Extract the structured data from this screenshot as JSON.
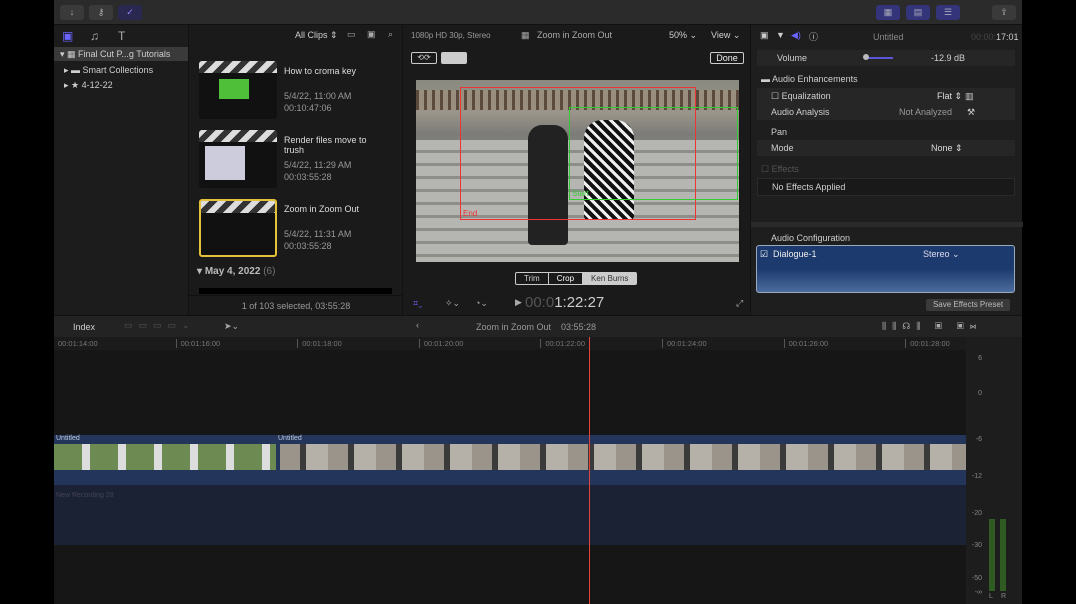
{
  "toolbar": {
    "import_icon": "download-arrow-icon",
    "keywords_icon": "key-icon",
    "background_tasks_icon": "checkmark-circle-icon",
    "accent": "#5b55d8"
  },
  "library": {
    "items": [
      {
        "label": "Final Cut P...g Tutorials"
      },
      {
        "label": "Smart Collections"
      },
      {
        "label": "4-12-22"
      }
    ]
  },
  "browser": {
    "filter": "All Clips",
    "clips": [
      {
        "title": "How to croma key",
        "date": "5/4/22, 11:00 AM",
        "duration": "00:10:47:06"
      },
      {
        "title": "Render files move to trush",
        "date": "5/4/22, 11:29 AM",
        "duration": "00:03:55:28"
      },
      {
        "title": "Zoom in Zoom Out",
        "date": "5/4/22, 11:31 AM",
        "duration": "00:03:55:28"
      }
    ],
    "group_label": "May 4, 2022",
    "group_count": "(6)",
    "status": "1 of 103 selected, 03:55:28"
  },
  "viewer": {
    "format": "1080p HD 30p, Stereo",
    "title": "Zoom in Zoom Out",
    "zoom": "50%",
    "view": "View",
    "done": "Done",
    "end_label": "End",
    "start_label": "Start",
    "modes": [
      "Trim",
      "Crop",
      "Ken Burns"
    ],
    "active_mode": "Crop",
    "timecode_dim": "00:0",
    "timecode": "1:22:27"
  },
  "inspector": {
    "title": "Untitled",
    "tc_dim": "00:00:",
    "tc": "17:01",
    "volume_label": "Volume",
    "volume_value": "-12.9 dB",
    "volume_level": 0.45,
    "enhancements": "Audio Enhancements",
    "eq_label": "Equalization",
    "eq_value": "Flat",
    "analysis_label": "Audio Analysis",
    "analysis_value": "Not Analyzed",
    "pan_label": "Pan",
    "mode_label": "Mode",
    "mode_value": "None",
    "effects_label": "Effects",
    "no_effects": "No Effects Applied",
    "config_label": "Audio Configuration",
    "channel": "Dialogue-1",
    "channel_mode": "Stereo",
    "save_preset": "Save Effects Preset"
  },
  "timeline": {
    "index": "Index",
    "project": "Zoom in Zoom Out",
    "duration": "03:55:28",
    "ruler": [
      "00:01:14:00",
      "00:01:16:00",
      "00:01:18:00",
      "00:01:20:00",
      "00:01:22:00",
      "00:01:24:00",
      "00:01:26:00",
      "00:01:28:00"
    ],
    "clips": [
      {
        "label": "Untitled"
      },
      {
        "label": "Untitled"
      }
    ],
    "audio_clip": "New Recording 28",
    "playhead_color": "#e0443a"
  },
  "meters": {
    "labels": [
      "6",
      "0",
      "-6",
      "-12",
      "-20",
      "-30",
      "-50",
      "-∞"
    ],
    "channels": [
      "L",
      "R"
    ],
    "level_db": -21
  }
}
